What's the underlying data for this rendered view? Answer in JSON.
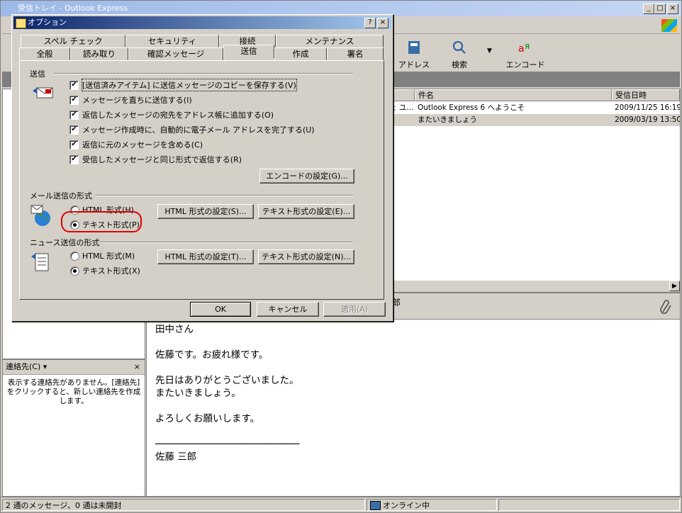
{
  "main_window": {
    "title": "受信トレイ - Outlook Express",
    "toolbar": {
      "address_label": "アドレス",
      "search_label": "検索",
      "encode_label": "エンコード"
    }
  },
  "message_list": {
    "columns": {
      "subject": "件名",
      "received": "受信日時"
    },
    "rows": [
      {
        "from_fragment": "ェ ユ...",
        "subject": "Outlook Express 6 へようこそ",
        "received": "2009/11/25 16:19"
      },
      {
        "from_fragment": "",
        "subject": "またいきましょう",
        "received": "2009/03/19 13:50"
      }
    ]
  },
  "preview": {
    "header_fragment": "郎",
    "body": "田中さん\n\n佐藤です。お疲れ様です。\n\n先日はありがとうございました。\nまたいきましょう。\n\nよろしくお願いします。\n\n─────────────────────────\n佐藤 三郎"
  },
  "contacts": {
    "header": "連絡先(C) ▾",
    "close": "×",
    "message": "表示する連絡先がありません。[連絡先] をクリックすると、新しい連絡先を作成します。"
  },
  "status_bar": {
    "messages": "2 通のメッセージ、0 通は未開封",
    "online": "オンライン中"
  },
  "dialog": {
    "title": "オプション",
    "help_btn": "?",
    "close_btn": "×",
    "tabs_row1": [
      "スペル チェック",
      "セキュリティ",
      "接続",
      "メンテナンス"
    ],
    "tabs_row2": [
      "全般",
      "読み取り",
      "確認メッセージ",
      "送信",
      "作成",
      "署名"
    ],
    "active_tab": "送信",
    "send_group": {
      "title": "送信",
      "options": [
        "[送信済みアイテム] に送信メッセージのコピーを保存する(V)",
        "メッセージを直ちに送信する(I)",
        "返信したメッセージの宛先をアドレス帳に追加する(O)",
        "メッセージ作成時に、自動的に電子メール アドレスを完了する(U)",
        "返信に元のメッセージを含める(C)",
        "受信したメッセージと同じ形式で返信する(R)"
      ],
      "encode_button": "エンコードの設定(G)..."
    },
    "mail_format": {
      "title": "メール送信の形式",
      "html_option": "HTML 形式(H)",
      "text_option": "テキスト形式(P)",
      "html_settings": "HTML 形式の設定(S)...",
      "text_settings": "テキスト形式の設定(E)..."
    },
    "news_format": {
      "title": "ニュース送信の形式",
      "html_option": "HTML 形式(M)",
      "text_option": "テキスト形式(X)",
      "html_settings": "HTML 形式の設定(T)...",
      "text_settings": "テキスト形式の設定(N)..."
    },
    "ok": "OK",
    "cancel": "キャンセル",
    "apply": "適用(A)"
  }
}
